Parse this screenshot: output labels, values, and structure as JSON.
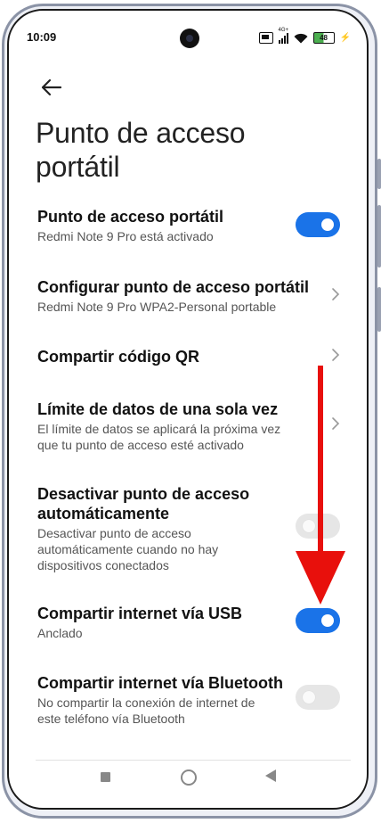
{
  "status_bar": {
    "time": "10:09",
    "network": "4G+",
    "battery": "48"
  },
  "page": {
    "title_line1": "Punto de acceso",
    "title_line2": "portátil"
  },
  "settings": [
    {
      "title": "Punto de acceso portátil",
      "subtitle": "Redmi Note 9 Pro está activado",
      "control": "toggle",
      "state": "on"
    },
    {
      "title": "Configurar punto de acceso portátil",
      "subtitle": "Redmi Note 9 Pro WPA2-Personal portable",
      "control": "chevron"
    },
    {
      "title": "Compartir código QR",
      "control": "chevron"
    },
    {
      "title": "Límite de datos de una sola vez",
      "subtitle_line1": "El límite de datos se aplicará la próxima vez",
      "subtitle_line2": "que tu punto de acceso esté activado",
      "control": "chevron"
    },
    {
      "title_line1": "Desactivar punto de acceso",
      "title_line2": "automáticamente",
      "subtitle_line1": "Desactivar punto de acceso",
      "subtitle_line2": "automáticamente cuando no hay",
      "subtitle_line3": "dispositivos conectados",
      "control": "toggle",
      "state": "off"
    },
    {
      "title": "Compartir internet vía USB",
      "subtitle": "Anclado",
      "control": "toggle",
      "state": "on"
    },
    {
      "title": "Compartir internet vía Bluetooth",
      "subtitle_line1": "No compartir la conexión de internet de",
      "subtitle_line2": "este teléfono vía Bluetooth",
      "control": "toggle",
      "state": "off"
    }
  ],
  "colors": {
    "toggle_on": "#1a73e8",
    "toggle_off": "#e6e6e6",
    "annotation_arrow": "#e8100c"
  },
  "icons": [
    "back-arrow-icon",
    "chevron-right-icon",
    "sim-icon",
    "signal-icon",
    "wifi-icon",
    "battery-icon",
    "charging-icon"
  ]
}
